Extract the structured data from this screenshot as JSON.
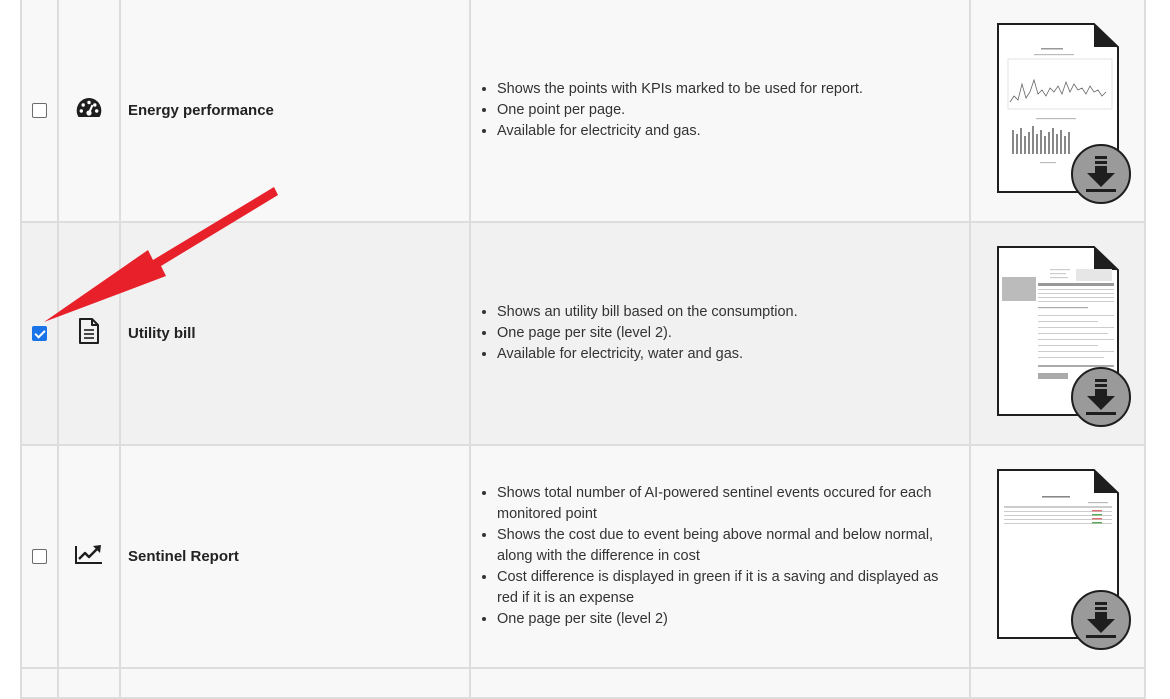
{
  "reports": [
    {
      "name": "Energy performance",
      "checked": false,
      "icon": "gauge-icon",
      "bullets": [
        "Shows the points with KPIs marked to be used for report.",
        "One point per page.",
        "Available for electricity and gas."
      ],
      "preview": "energy-performance-thumbnail"
    },
    {
      "name": "Utility bill",
      "checked": true,
      "icon": "document-icon",
      "bullets": [
        "Shows an utility bill based on the consumption.",
        "One page per site (level 2).",
        "Available for electricity, water and gas."
      ],
      "preview": "utility-bill-thumbnail"
    },
    {
      "name": "Sentinel Report",
      "checked": false,
      "icon": "trending-up-icon",
      "bullets": [
        "Shows total number of AI-powered sentinel events occured for each monitored point",
        "Shows the cost due to event being above normal and below normal, along with the difference in cost",
        "Cost difference is displayed in green if it is a saving and displayed as red if it is an expense",
        "One page per site (level 2)"
      ],
      "preview": "sentinel-report-thumbnail"
    }
  ],
  "annotation": {
    "color": "#e8202a"
  },
  "colors": {
    "checkbox_accent": "#1a73e8",
    "download_button": "#9a9a9a"
  }
}
